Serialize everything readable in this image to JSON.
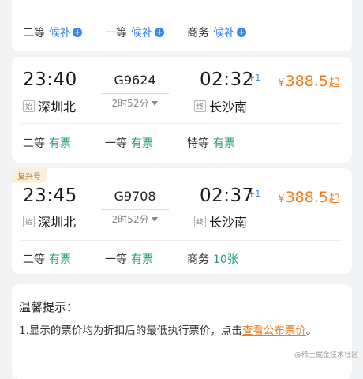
{
  "top_card": {
    "seats": [
      {
        "label": "二等",
        "status": "候补",
        "plus": "+"
      },
      {
        "label": "一等",
        "status": "候补",
        "plus": "+"
      },
      {
        "label": "商务",
        "status": "候补",
        "plus": "+"
      }
    ]
  },
  "trains": [
    {
      "badge": "",
      "depart_time": "23:40",
      "train_no": "G9624",
      "duration": "2时52分",
      "arrive_time": "02:32",
      "day_plus": "+1",
      "depart_tag": "始",
      "depart_station": "深圳北",
      "arrive_tag": "终",
      "arrive_station": "长沙南",
      "price_currency": "¥",
      "price": "388.5",
      "price_suffix": "起",
      "seats": [
        {
          "label": "二等",
          "status": "有票"
        },
        {
          "label": "一等",
          "status": "有票"
        },
        {
          "label": "特等",
          "status": "有票"
        }
      ]
    },
    {
      "badge": "复兴号",
      "depart_time": "23:45",
      "train_no": "G9708",
      "duration": "2时52分",
      "arrive_time": "02:37",
      "day_plus": "+1",
      "depart_tag": "始",
      "depart_station": "深圳北",
      "arrive_tag": "终",
      "arrive_station": "长沙南",
      "price_currency": "¥",
      "price": "388.5",
      "price_suffix": "起",
      "seats": [
        {
          "label": "二等",
          "status": "有票"
        },
        {
          "label": "一等",
          "status": "有票"
        },
        {
          "label": "商务",
          "status": "10张"
        }
      ]
    }
  ],
  "tips": {
    "title": "温馨提示：",
    "line1_prefix": "1.显示的票价均为折扣后的最低执行票价，点击",
    "line1_link": "查看公布票价",
    "line1_suffix": "。"
  },
  "watermark": "@稀土掘金技术社区",
  "colors": {
    "accent_orange": "#f07c1e",
    "available_green": "#22a06b",
    "waitlist_blue": "#3c84e6"
  }
}
